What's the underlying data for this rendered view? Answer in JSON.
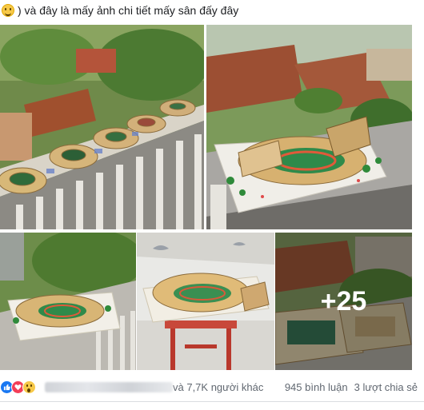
{
  "post": {
    "caption_text": ") và đây là mấy ảnh chi tiết mấy sân đấy đây",
    "caption_emoji": "smile-emoji"
  },
  "photos": {
    "more_count_label": "+25"
  },
  "stats": {
    "reactions": [
      "like",
      "love",
      "wow"
    ],
    "others_text": "và 7,7K người khác",
    "comments_text": "945 bình luận",
    "shares_text": "3 lượt chia sẻ"
  },
  "colors": {
    "like": "#1877f2",
    "love": "#f33e58",
    "wow": "#f7c948",
    "meta_text": "#606770"
  }
}
